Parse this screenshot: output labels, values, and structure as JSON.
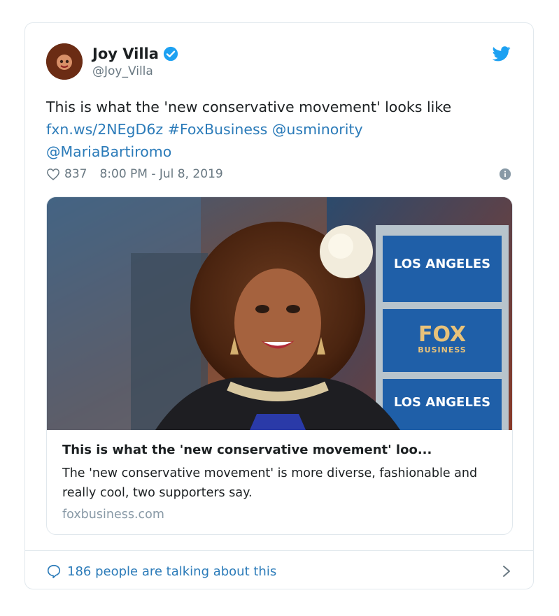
{
  "author": {
    "name": "Joy Villa",
    "handle": "@Joy_Villa"
  },
  "tweet": {
    "text_plain": "This is what the 'new conservative movement' looks like",
    "link": "fxn.ws/2NEgD6z",
    "hashtag": "#FoxBusiness",
    "mention1": "@usminority",
    "mention2": "@MariaBartiromo"
  },
  "meta": {
    "likes": "837",
    "timestamp": "8:00 PM - Jul 8, 2019"
  },
  "link_card": {
    "title": "This is what the 'new conservative movement' loo...",
    "description": "The 'new conservative movement' is more diverse, fashionable and really cool, two supporters say.",
    "domain": "foxbusiness.com",
    "sign_text_top": "LOS ANGELES",
    "sign_logo_main": "FOX",
    "sign_logo_sub": "BUSINESS",
    "sign_text_bottom": "LOS ANGELES"
  },
  "footer": {
    "talking_label": "186 people are talking about this"
  },
  "colors": {
    "link": "#2b7bb9",
    "twitter_blue": "#1da1f2",
    "muted": "#697882"
  }
}
